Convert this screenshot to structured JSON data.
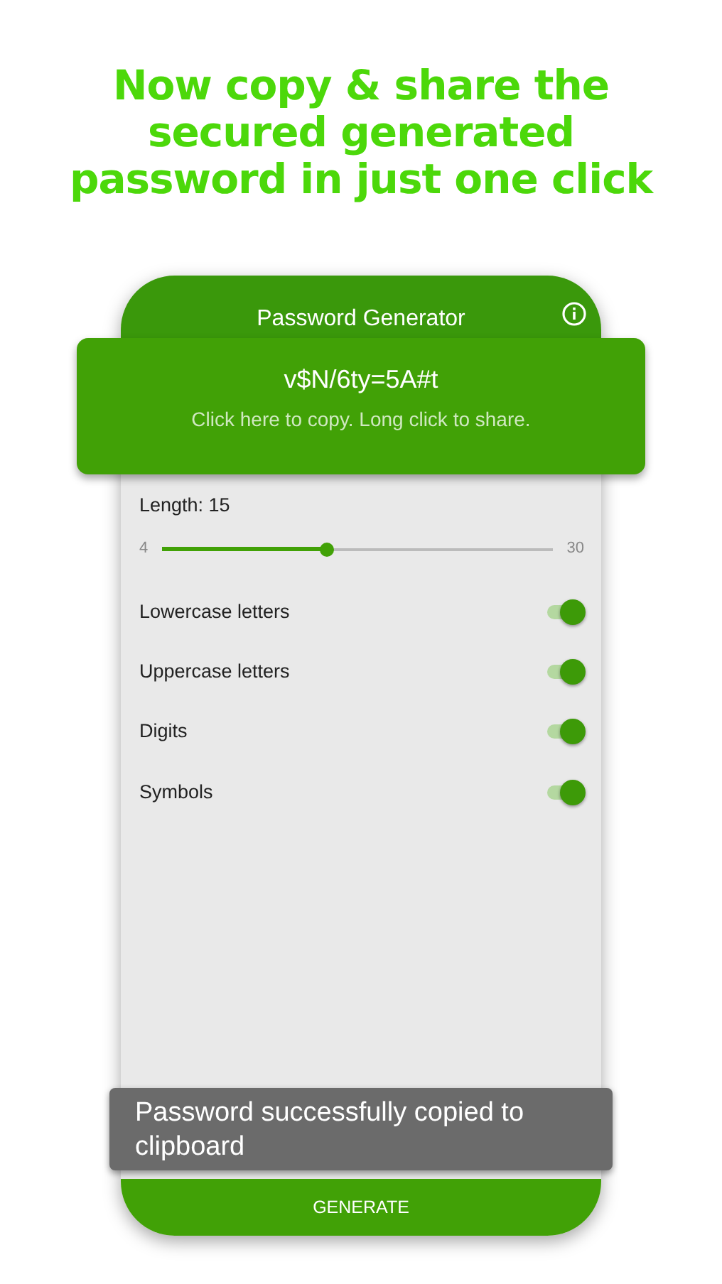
{
  "headline": "Now copy & share the secured generated password in just one click",
  "app_bar": {
    "title": "Password Generator"
  },
  "password_card": {
    "password": "v$N/6ty=5A#t",
    "hint": "Click here to copy. Long click to share."
  },
  "length": {
    "label": "Length: 15",
    "min": "4",
    "max": "30",
    "level": 0.423
  },
  "options": [
    {
      "label": "Lowercase letters",
      "on": true
    },
    {
      "label": "Uppercase letters",
      "on": true
    },
    {
      "label": "Digits",
      "on": true
    },
    {
      "label": "Symbols",
      "on": true
    }
  ],
  "snackbar": {
    "text": "Password successfully copied to clipboard"
  },
  "generate_button": {
    "label": "GENERATE"
  }
}
